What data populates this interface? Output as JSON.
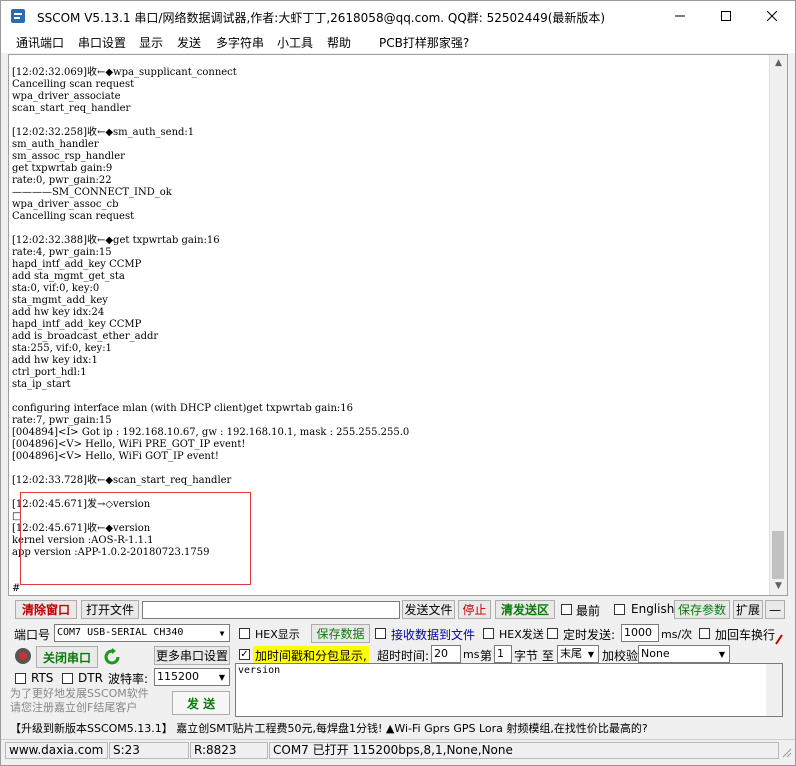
{
  "window": {
    "title": "SSCOM V5.13.1 串口/网络数据调试器,作者:大虾丁丁,2618058@qq.com. QQ群:  52502449(最新版本)",
    "minimize_icon": "minimize-icon",
    "maximize_icon": "maximize-icon",
    "close_icon": "close-icon"
  },
  "menu": [
    "通讯端口",
    "串口设置",
    "显示",
    "发送",
    "多字符串",
    "小工具",
    "帮助",
    "PCB打样那家强?"
  ],
  "output": {
    "lines": [
      "[12:02:32.069]收←◆wpa_supplicant_connect",
      "Cancelling scan request",
      "wpa_driver_associate",
      "scan_start_req_handler",
      "",
      "[12:02:32.258]收←◆sm_auth_send:1",
      "sm_auth_handler",
      "sm_assoc_rsp_handler",
      "get txpwrtab gain:9",
      "rate:0, pwr_gain:22",
      "————SM_CONNECT_IND_ok",
      "wpa_driver_assoc_cb",
      "Cancelling scan request",
      "",
      "[12:02:32.388]收←◆get txpwrtab gain:16",
      "rate:4, pwr_gain:15",
      "hapd_intf_add_key CCMP",
      "add sta_mgmt_get_sta",
      "sta:0, vif:0, key:0",
      "sta_mgmt_add_key",
      "add hw key idx:24",
      "hapd_intf_add_key CCMP",
      "add is_broadcast_ether_addr",
      "sta:255, vif:0, key:1",
      "add hw key idx:1",
      "ctrl_port_hdl:1",
      "sta_ip_start",
      "",
      "configuring interface mlan (with DHCP client)get txpwrtab gain:16",
      "rate:7, pwr_gain:15",
      "[004894]<I> Got ip : 192.168.10.67, gw : 192.168.10.1, mask : 255.255.255.0",
      "[004896]<V> Hello, WiFi PRE_GOT_IP event!",
      "[004896]<V> Hello, WiFi GOT_IP event!",
      "",
      "[12:02:33.728]收←◆scan_start_req_handler",
      "",
      "[12:02:45.671]发→◇version",
      "□",
      "[12:02:45.671]收←◆version",
      "kernel version :AOS-R-1.1.1",
      "app version :APP-1.0.2-20180723.1759",
      "",
      "",
      "#",
      "#"
    ]
  },
  "controls": {
    "clear_window": "清除窗口",
    "open_file": "打开文件",
    "send_file": "发送文件",
    "stop": "停止",
    "clear_send": "清发送区",
    "last": "最前",
    "english": "English",
    "save_params": "保存参数",
    "expand": "扩展",
    "collapse": "—",
    "port_label": "端口号",
    "port_value": "COM7 USB-SERIAL CH340",
    "hex_display": "HEX显示",
    "save_data": "保存数据",
    "recv_to_file": "接收数据到文件",
    "hex_send": "HEX发送",
    "timed_send": "定时发送:",
    "timed_value": "1000",
    "timed_unit": "ms/次",
    "add_crlf": "加回车换行",
    "close_port": "关闭串口",
    "more_settings": "更多串口设置",
    "timestamp": "加时间戳和分包显示,",
    "timeout_label": "超时时间:",
    "timeout_value": "20",
    "timeout_unit": "ms",
    "nth_label": "第",
    "nth_value": "1",
    "byte_label": "字节 至",
    "end_value": "末尾",
    "checksum_label": "加校验",
    "checksum_value": "None",
    "rts": "RTS",
    "dtr": "DTR",
    "baud_label": "波特率:",
    "baud_value": "115200",
    "send_input": "version",
    "promo": "为了更好地发展SSCOM软件\n请您注册嘉立创F结尾客户",
    "send": "发  送",
    "ad": "【升级到新版本SSCOM5.13.1】  嘉立创SMT贴片工程费50元,每焊盘1分钱! ▲Wi-Fi Gprs GPS Lora 射频模组,在找性价比最高的?"
  },
  "status": {
    "website": "www.daxia.com",
    "sent": "S:23",
    "received": "R:8823",
    "port_status": "COM7 已打开  115200bps,8,1,None,None"
  },
  "colors": {
    "red_box": "#e0393e",
    "highlight": "#ffff00",
    "green": "#0a7a0a",
    "red_text": "#c00000"
  }
}
